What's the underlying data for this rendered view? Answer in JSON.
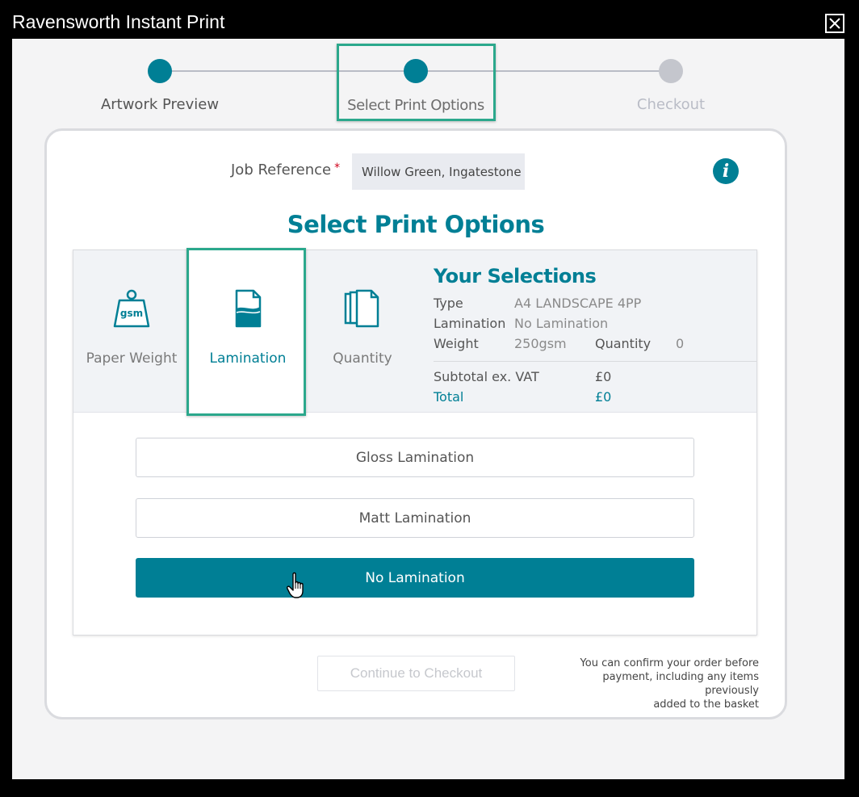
{
  "window": {
    "title": "Ravensworth Instant Print"
  },
  "stepper": {
    "steps": [
      {
        "label": "Artwork Preview",
        "state": "complete"
      },
      {
        "label": "Select Print Options",
        "state": "active"
      },
      {
        "label": "Checkout",
        "state": "pending"
      }
    ]
  },
  "job_reference": {
    "label": "Job Reference",
    "required_marker": "*",
    "value": "Willow Green, Ingatestone"
  },
  "section_title": "Select Print Options",
  "tabs": [
    {
      "label": "Paper Weight",
      "icon": "gsm-weight-icon",
      "icon_text": "gsm",
      "active": false
    },
    {
      "label": "Lamination",
      "icon": "lamination-page-icon",
      "active": true
    },
    {
      "label": "Quantity",
      "icon": "stacked-pages-icon",
      "active": false
    }
  ],
  "selections": {
    "title": "Your Selections",
    "type_label": "Type",
    "type_value": "A4 LANDSCAPE 4PP",
    "lamination_label": "Lamination",
    "lamination_value": "No Lamination",
    "weight_label": "Weight",
    "weight_value": "250gsm",
    "quantity_label": "Quantity",
    "quantity_value": "0",
    "subtotal_label": "Subtotal ex. VAT",
    "subtotal_value": "£0",
    "total_label": "Total",
    "total_value": "£0"
  },
  "lamination_options": [
    {
      "label": "Gloss Lamination",
      "selected": false
    },
    {
      "label": "Matt Lamination",
      "selected": false
    },
    {
      "label": "No Lamination",
      "selected": true
    }
  ],
  "checkout": {
    "button_label": "Continue to Checkout",
    "note_line1": "You can confirm your order before",
    "note_line2": "payment, including any items previously",
    "note_line3": "added to the basket"
  },
  "colors": {
    "accent": "#007f95",
    "highlight": "#2ba88c",
    "pending_step": "#c4c6cd"
  }
}
